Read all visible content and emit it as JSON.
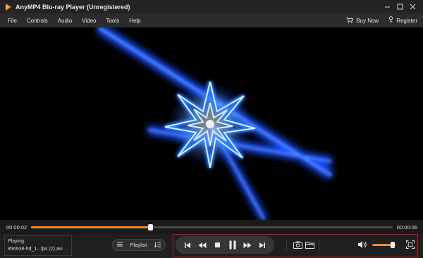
{
  "window": {
    "title": "AnyMP4 Blu-ray Player (Unregistered)",
    "logo_icon": "play-triangle-logo",
    "accent_color": "#e98a3a"
  },
  "menu": {
    "items": [
      "File",
      "Controls",
      "Audio",
      "Video",
      "Tools",
      "Help"
    ],
    "buy_now": "Buy Now",
    "register": "Register"
  },
  "playback": {
    "current_time": "00:00:02",
    "total_time": "00:00:06",
    "progress_fraction": 0.33,
    "volume_fraction": 0.85
  },
  "now_playing": {
    "label": "Playing:",
    "file": "856938-hd_1...fps (2).avi"
  },
  "playlist": {
    "label": "Playlist"
  },
  "controls": {
    "icons": [
      "skip-previous-icon",
      "rewind-icon",
      "stop-icon",
      "pause-icon",
      "fast-forward-icon",
      "skip-next-icon",
      "snapshot-icon",
      "open-folder-icon",
      "volume-icon",
      "fullscreen-icon"
    ],
    "highlight_color": "#c4181c"
  }
}
